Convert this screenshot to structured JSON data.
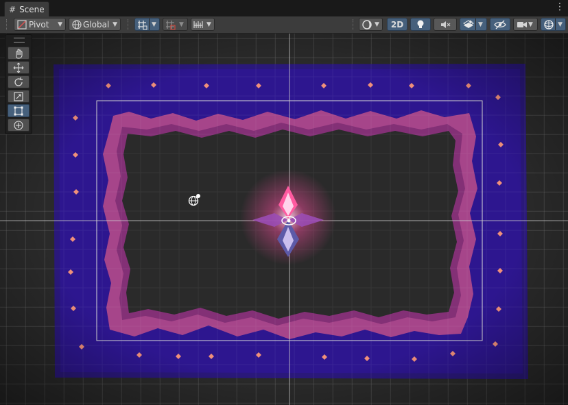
{
  "window": {
    "tab_label": "Scene",
    "tab_icon": "grid-hash-icon"
  },
  "toolbar": {
    "pivot_label": "Pivot",
    "global_label": "Global",
    "mode_2d_label": "2D",
    "active_color": "#46607c"
  },
  "tool_palette": {
    "tools": [
      {
        "name": "hand-tool",
        "icon": "hand-icon",
        "active": false
      },
      {
        "name": "move-tool",
        "icon": "move-arrows-icon",
        "active": false
      },
      {
        "name": "rotate-tool",
        "icon": "rotate-icon",
        "active": false
      },
      {
        "name": "scale-tool",
        "icon": "scale-icon",
        "active": false
      },
      {
        "name": "rect-tool",
        "icon": "rect-transform-icon",
        "active": true
      },
      {
        "name": "transform-tool",
        "icon": "transform-icon",
        "active": false
      }
    ]
  },
  "scene": {
    "outer_color": "#2a1780",
    "border_color": "#b44a8a",
    "floor_color": "#2a2a2a",
    "marker_color": "#f0907a"
  }
}
